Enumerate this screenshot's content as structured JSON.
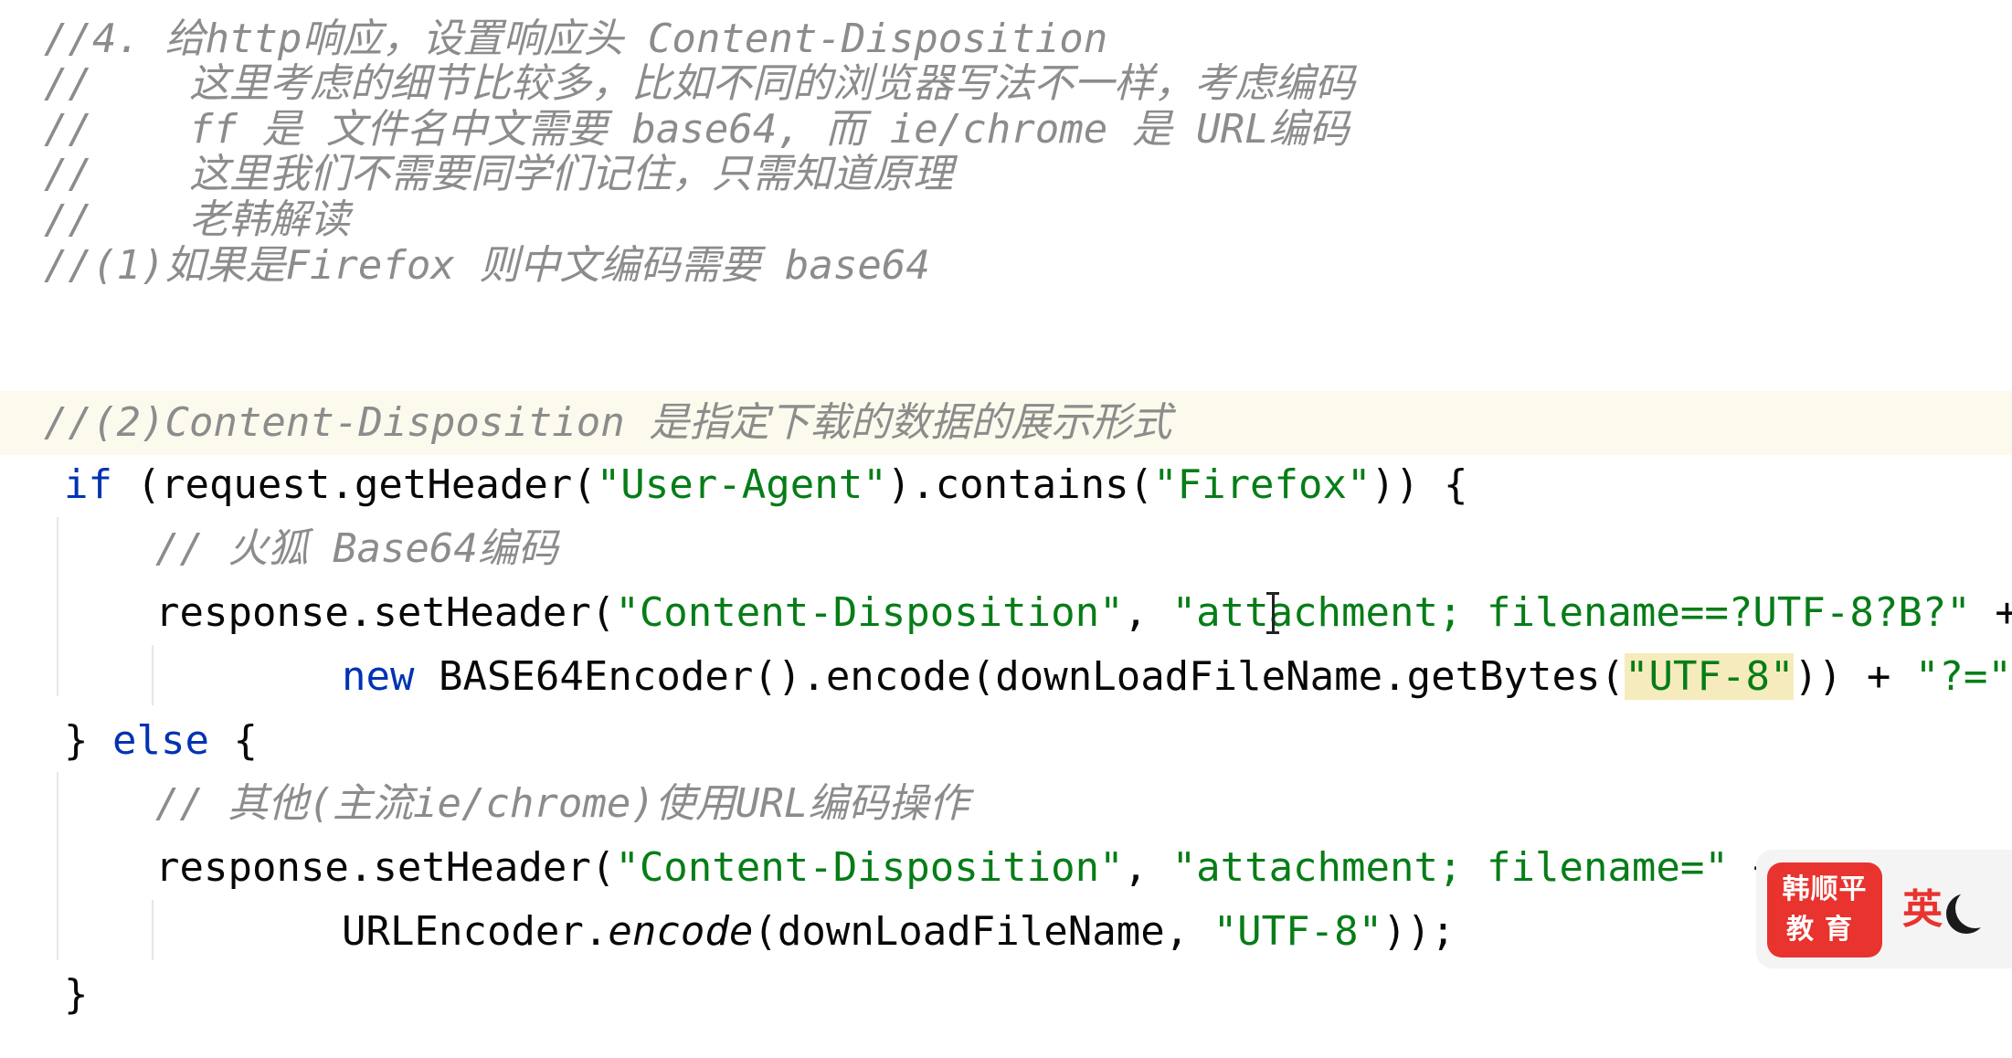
{
  "code": {
    "l1": "//4. 给http响应，设置响应头 Content-Disposition",
    "l2": "//    这里考虑的细节比较多，比如不同的浏览器写法不一样，考虑编码",
    "l3": "//    ff 是 文件名中文需要 base64, 而 ie/chrome 是 URL编码",
    "l4": "//    这里我们不需要同学们记住，只需知道原理",
    "l5": "//    老韩解读",
    "l6": "//(1)如果是Firefox 则中文编码需要 base64",
    "l7": "//(2)Content-Disposition 是指定下载的数据的展示形式",
    "l8": {
      "kw_if": "if",
      "p1": " (request.getHeader(",
      "s1": "\"User-Agent\"",
      "p2": ").contains(",
      "s2": "\"Firefox\"",
      "p3": ")) {"
    },
    "l9": "// 火狐 Base64编码",
    "l10": {
      "p1": "response.setHeader(",
      "s1": "\"Content-Disposition\"",
      "p2": ", ",
      "s2": "\"attachment; filename==?UTF-8?B?\"",
      "p3": " +"
    },
    "l11": {
      "kw_new": "new",
      "p1": " BASE64Encoder().encode(downLoadFileName.getBytes(",
      "s1": "\"UTF-8\"",
      "p2": ")) + ",
      "s2": "\"?=\"",
      "p3": ");"
    },
    "l12": {
      "p1": "} ",
      "kw_else": "else",
      "p2": " {"
    },
    "l13": "// 其他(主流ie/chrome)使用URL编码操作",
    "l14": {
      "p1": "response.setHeader(",
      "s1": "\"Content-Disposition\"",
      "p2": ", ",
      "s2": "\"attachment; filename=\"",
      "p3": " +"
    },
    "l15": {
      "p1": "URLEncoder.",
      "m1": "encode",
      "p2": "(downLoadFileName, ",
      "s1": "\"UTF-8\"",
      "p3": "));"
    },
    "l16": "}"
  },
  "watermark": {
    "logo_line1": "韩顺平",
    "logo_line2": "教育",
    "ime_language": "英",
    "ime_icon": "moon-icon"
  },
  "colors": {
    "keyword": "#0033b3",
    "string": "#067d17",
    "comment": "#8c8c8c",
    "current_line": "#fcfaed",
    "brace_match": "#f6ebbc",
    "brand": "#e8332f"
  }
}
